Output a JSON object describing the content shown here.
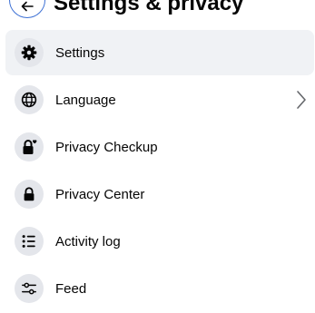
{
  "header": {
    "title": "Settings & privacy",
    "back_icon": "arrow-left-icon"
  },
  "colors": {
    "active_bg": "#f0f2f5",
    "icon_bg": "#e4e6eb",
    "back_border": "#3b6fd4"
  },
  "menu": {
    "items": [
      {
        "label": "Settings",
        "icon": "gear-icon",
        "active": true
      },
      {
        "label": "Language",
        "icon": "globe-icon",
        "has_chevron": true
      },
      {
        "label": "Privacy Checkup",
        "icon": "lock-heart-icon"
      },
      {
        "label": "Privacy Center",
        "icon": "lock-icon"
      },
      {
        "label": "Activity log",
        "icon": "list-icon"
      },
      {
        "label": "Feed",
        "icon": "sliders-icon"
      }
    ]
  }
}
